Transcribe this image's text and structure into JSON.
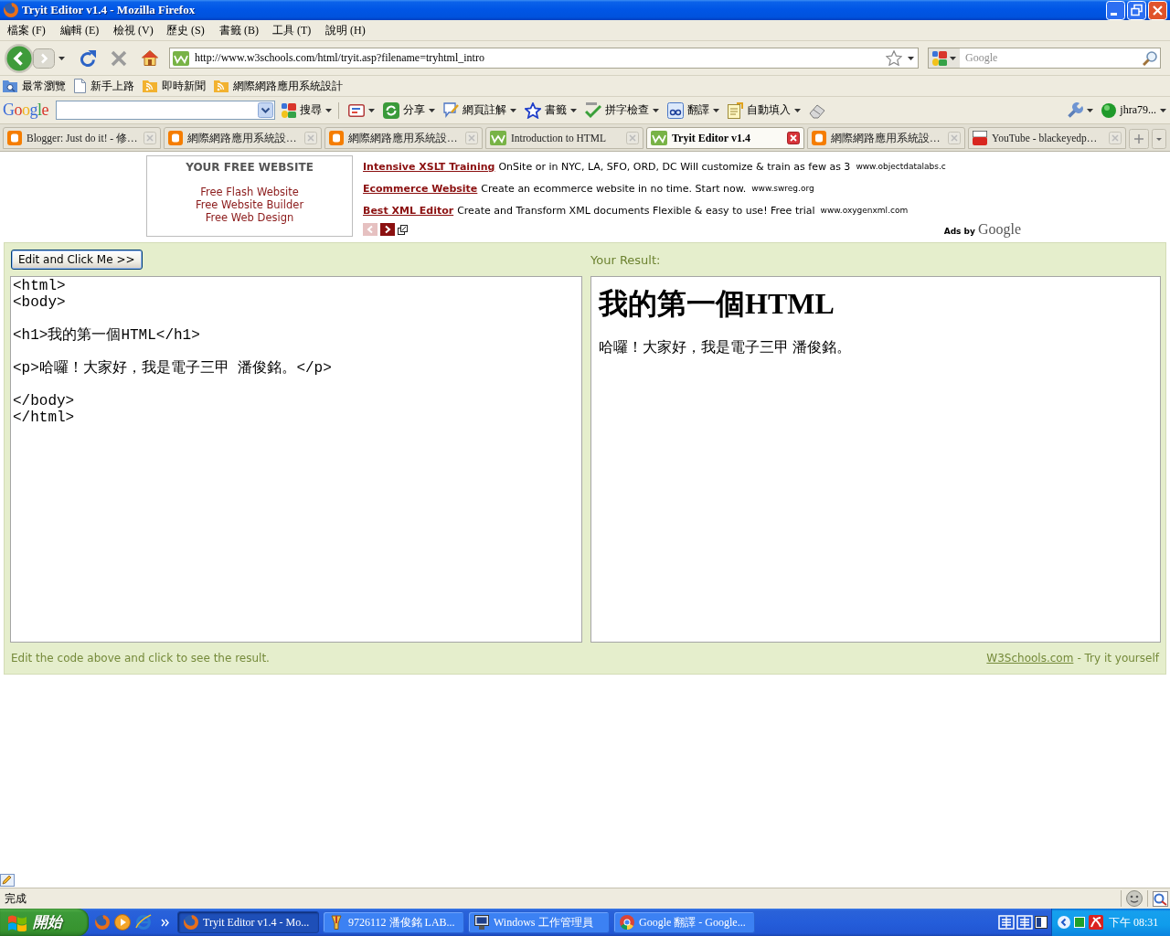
{
  "window": {
    "title": "Tryit Editor v1.4 - Mozilla Firefox"
  },
  "menu": [
    "檔案 (F)",
    "編輯 (E)",
    "檢視 (V)",
    "歷史 (S)",
    "書籤 (B)",
    "工具 (T)",
    "說明 (H)"
  ],
  "address_bar": {
    "url": "http://www.w3schools.com/html/tryit.asp?filename=tryhtml_intro"
  },
  "search": {
    "placeholder": "Google"
  },
  "bookmarks": [
    "最常瀏覽",
    "新手上路",
    "即時新聞",
    "網際網路應用系統設計"
  ],
  "google_toolbar": {
    "logo": "Google",
    "items": [
      "搜尋",
      "分享",
      "網頁註解",
      "書籤",
      "拼字檢查",
      "翻譯",
      "自動填入"
    ],
    "account": "jhra79..."
  },
  "tabs": [
    {
      "label": "Blogger: Just do it! - 修…",
      "selected": false
    },
    {
      "label": "網際網路應用系統設…",
      "selected": false
    },
    {
      "label": "網際網路應用系統設…",
      "selected": false
    },
    {
      "label": "Introduction to HTML",
      "selected": false
    },
    {
      "label": "Tryit Editor v1.4",
      "selected": true
    },
    {
      "label": "網際網路應用系統設…",
      "selected": false
    },
    {
      "label": "YouTube - blackeyedp…",
      "selected": false
    }
  ],
  "content": {
    "sidebar_ad": {
      "title": "YOUR FREE WEBSITE",
      "links": [
        "Free Flash Website",
        "Free Website Builder",
        "Free Web Design"
      ]
    },
    "ads": [
      {
        "title": "Intensive XSLT Training",
        "text": "OnSite or in NYC, LA, SFO, ORD, DC Will customize & train as few as 3",
        "url": "www.objectdatalabs.c"
      },
      {
        "title": "Ecommerce Website",
        "text": "Create an ecommerce website in no time. Start now.",
        "url": "www.swreg.org"
      },
      {
        "title": "Best XML Editor",
        "text": "Create and Transform XML documents Flexible & easy to use! Free trial",
        "url": "www.oxygenxml.com"
      }
    ],
    "ad_nav": {
      "previous_disabled": true,
      "next_disabled": false
    },
    "ads_by": "Ads by",
    "ads_brand": "Google"
  },
  "editor": {
    "button": "Edit and Click Me >>",
    "result_label": "Your Result:",
    "code": "<html>\n<body>\n\n<h1>我的第一個HTML</h1>\n\n<p>哈囉！大家好，我是電子三甲 潘俊銘。</p>\n\n</body>\n</html>",
    "result": {
      "heading": "我的第一個HTML",
      "paragraph": "哈囉！大家好，我是電子三甲 潘俊銘。"
    },
    "hint": "Edit the code above and click to see the result.",
    "footer_link": "W3Schools.com",
    "footer_text": "- Try it yourself"
  },
  "status_bar": {
    "text": "完成"
  },
  "taskbar": {
    "start": "開始",
    "tasks": [
      {
        "label": "Tryit Editor v1.4 - Mo...",
        "selected": true
      },
      {
        "label": "9726112 潘俊銘 LAB...",
        "selected": false
      },
      {
        "label": "Windows 工作管理員",
        "selected": false
      },
      {
        "label": "Google 翻譯 - Google...",
        "selected": false
      }
    ],
    "clock": "下午 08:31"
  }
}
